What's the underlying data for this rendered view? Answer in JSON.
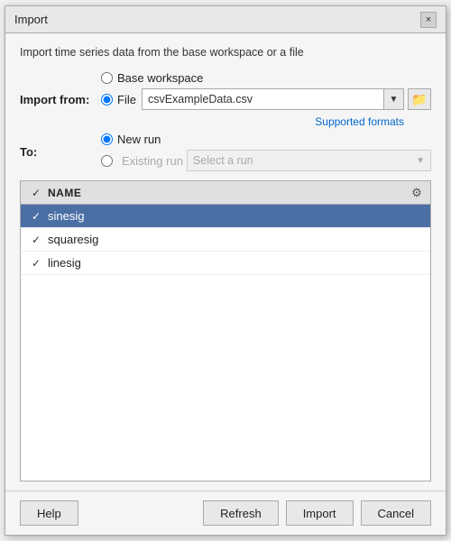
{
  "dialog": {
    "title": "Import",
    "close_label": "×"
  },
  "description": "Import time series data from the base workspace or a file",
  "import_from": {
    "label": "Import from:",
    "base_workspace_option": "Base workspace",
    "file_option": "File",
    "file_value": "csvExampleData.csv",
    "supported_formats_link": "Supported formats"
  },
  "to": {
    "label": "To:",
    "new_run_option": "New run",
    "existing_run_option": "Existing run",
    "select_run_placeholder": "Select a run"
  },
  "table": {
    "header_name": "NAME",
    "rows": [
      {
        "name": "sinesig",
        "checked": true,
        "selected": true
      },
      {
        "name": "squaresig",
        "checked": true,
        "selected": false
      },
      {
        "name": "linesig",
        "checked": true,
        "selected": false
      }
    ]
  },
  "buttons": {
    "help": "Help",
    "refresh": "Refresh",
    "import": "Import",
    "cancel": "Cancel"
  }
}
